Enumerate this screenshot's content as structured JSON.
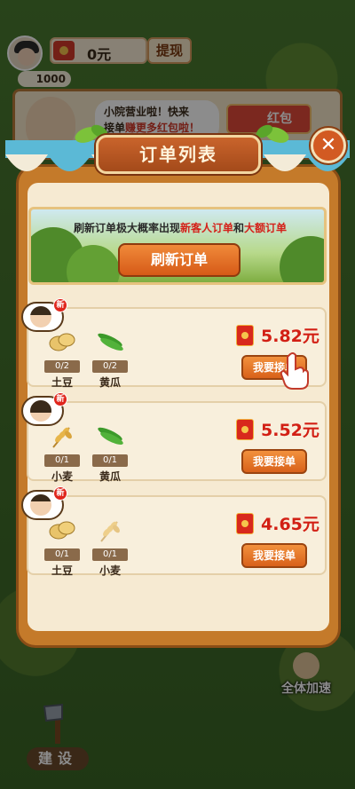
{
  "top": {
    "coins": "1000",
    "cash": "0元",
    "withdraw": "提现",
    "speech_line1": "小院营业啦！快来",
    "speech_line2a": "接单",
    "speech_line2b": "赚更多红包啦！",
    "hongbao": "红包"
  },
  "modal": {
    "title": "订单列表",
    "close": "✕",
    "promo_text_a": "刷新订单极大概率出现",
    "promo_text_b": "新客人订单",
    "promo_text_c": "和",
    "promo_text_d": "大额订单",
    "refresh": "刷新订单"
  },
  "orders": [
    {
      "badge": "新",
      "items": [
        {
          "name": "土豆",
          "count": "0/2",
          "icon": "potato-icon"
        },
        {
          "name": "黄瓜",
          "count": "0/2",
          "icon": "cucumber-icon"
        }
      ],
      "reward": "5.82元",
      "accept": "我要接单"
    },
    {
      "badge": "新",
      "items": [
        {
          "name": "小麦",
          "count": "0/1",
          "icon": "wheat-icon"
        },
        {
          "name": "黄瓜",
          "count": "0/1",
          "icon": "cucumber-icon"
        }
      ],
      "reward": "5.52元",
      "accept": "我要接单"
    },
    {
      "badge": "新",
      "items": [
        {
          "name": "土豆",
          "count": "0/1",
          "icon": "potato-icon"
        },
        {
          "name": "小麦",
          "count": "0/1",
          "icon": "wheat-icon"
        }
      ],
      "reward": "4.65元",
      "accept": "我要接单"
    }
  ],
  "bottom": {
    "speedup": "全体加速",
    "build": "建设"
  },
  "colors": {
    "accent_orange": "#d8611a",
    "reward_red": "#d21f14",
    "panel_cream": "#f6ead2"
  }
}
